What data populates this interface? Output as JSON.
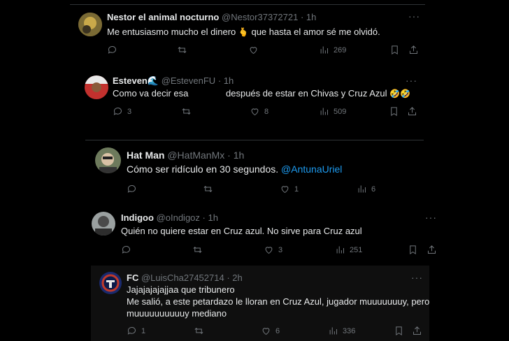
{
  "posts": [
    {
      "name": "Nestor el animal nocturno",
      "handle": "@Nestor37372721",
      "dot": "·",
      "time": "1h",
      "text_before": "Me entusiasmo mucho el dinero",
      "emoji": "🫰",
      "text_after": "que hasta el amor sé me olvidó.",
      "replies": "",
      "retweets": "",
      "likes": "",
      "views": "269"
    },
    {
      "name": "Esteven🌊",
      "handle": "@EstevenFU",
      "dot": "·",
      "time": "1h",
      "text_before": "Como va decir esa",
      "text_after": "después de estar en Chivas y Cruz Azul",
      "emoji": "🤣🤣",
      "replies": "3",
      "retweets": "",
      "likes": "8",
      "views": "509"
    },
    {
      "name": "Hat Man",
      "handle": "@HatManMx",
      "dot": "·",
      "time": "1h",
      "text": "Cómo ser ridículo en 30 segundos.",
      "mention": "@AntunaUriel",
      "replies": "",
      "retweets": "",
      "likes": "1",
      "views": "6"
    },
    {
      "name": "Indigoo",
      "handle": "@oIndigoz",
      "dot": "·",
      "time": "1h",
      "text": "Quién no quiere estar en Cruz azul. No sirve para Cruz azul",
      "replies": "",
      "retweets": "",
      "likes": "3",
      "views": "251"
    },
    {
      "name": "FC",
      "handle": "@LuisCha27452714",
      "dot": "·",
      "time": "2h",
      "lines": [
        "Jajajajajajjaa que tribunero",
        "Me salió, a este petardazo le lloran en Cruz Azul, jugador muuuuuuuy, pero",
        "muuuuuuuuuuy mediano"
      ],
      "replies": "1",
      "retweets": "",
      "likes": "6",
      "views": "336"
    }
  ],
  "more_label": "···",
  "colors": {
    "background": "#000000",
    "panel": "#0f0f0f",
    "text": "#e7e9ea",
    "muted": "#71767b",
    "link": "#1d9bf0",
    "divider": "#2f3336"
  }
}
